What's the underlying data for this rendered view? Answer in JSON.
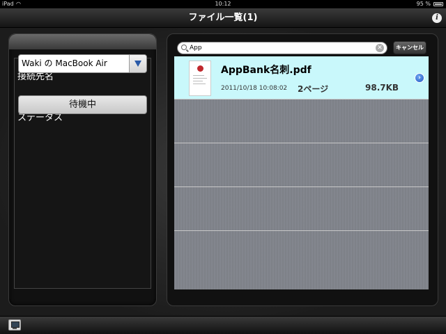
{
  "status_bar": {
    "carrier": "iPad",
    "time": "10:12",
    "battery": "95 %"
  },
  "nav": {
    "title": "ファイル一覧(1)",
    "info_icon": "info-icon"
  },
  "left_panel": {
    "connection_label": "接続先名",
    "connection_value": "Waki の MacBook Air",
    "status_label": "ステータス",
    "status_value": "待機中"
  },
  "search": {
    "value": "App",
    "cancel_label": "キャンセル"
  },
  "files": [
    {
      "name": "AppBank名刺.pdf",
      "date": "2011/10/18 10:08:02",
      "pages": "2ページ",
      "size": "98.7KB",
      "selected": true
    }
  ],
  "icons": {
    "search": "search-icon",
    "clear": "clear-icon",
    "disclosure": "disclosure-icon",
    "computer": "computer-icon"
  }
}
